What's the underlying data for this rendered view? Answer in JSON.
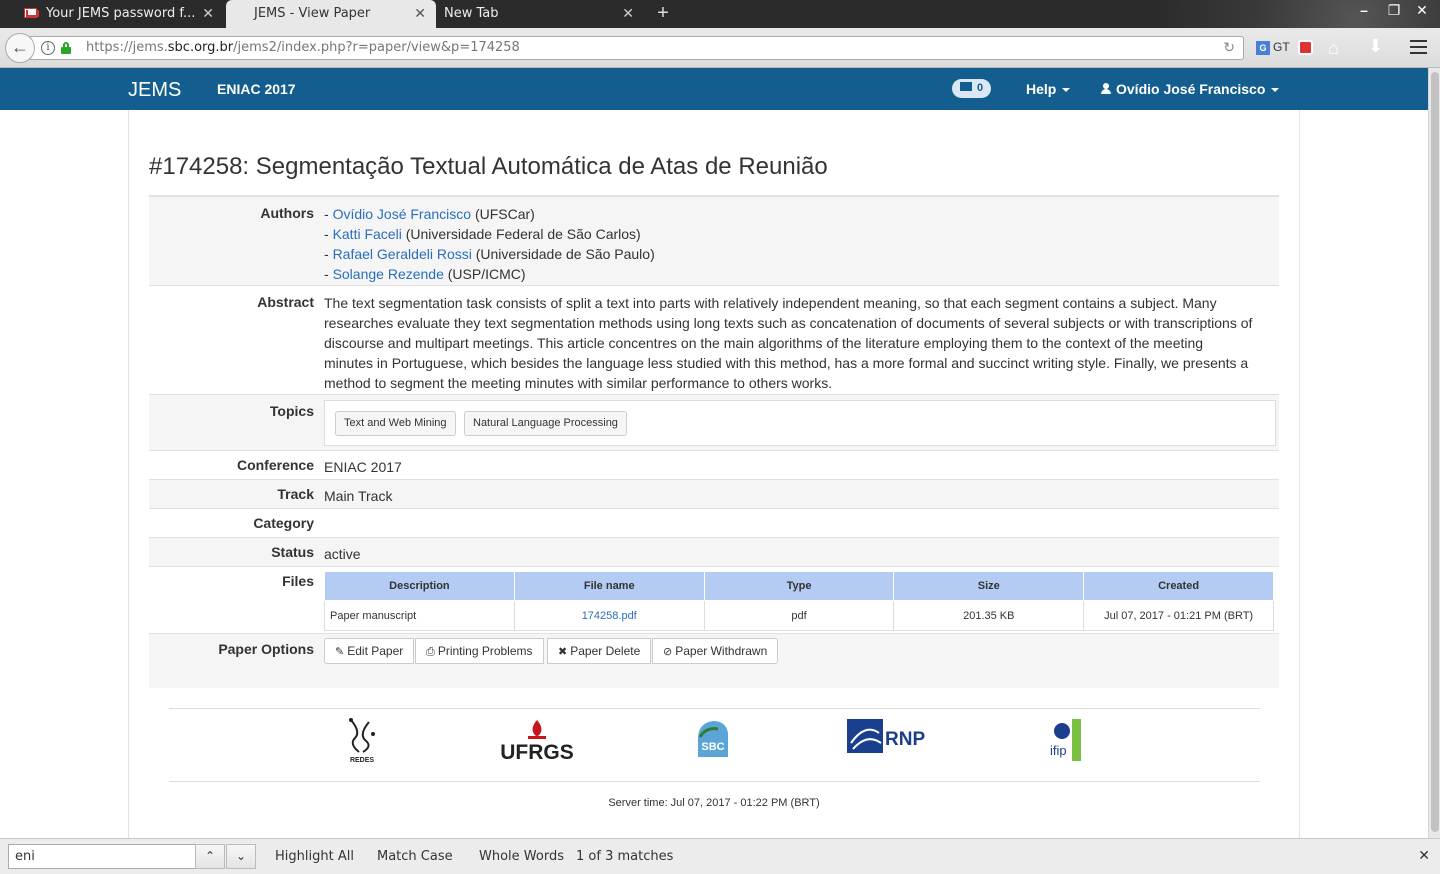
{
  "browser": {
    "tabs": [
      {
        "title": "Your JEMS password f...",
        "active": false
      },
      {
        "title": "JEMS - View Paper",
        "active": true
      },
      {
        "title": "New Tab",
        "active": false
      }
    ],
    "url_prefix": "https://jems.",
    "url_domain": "sbc.org.br",
    "url_suffix": "/jems2/index.php?r=paper/view&p=174258",
    "gt_label": "GT"
  },
  "app": {
    "brand": "JEMS",
    "conference": "ENIAC 2017",
    "messages_count": "0",
    "help_label": "Help",
    "user_name": "Ovídio José Francisco"
  },
  "paper": {
    "title": "#174258: Segmentação Textual Automática de Atas de Reunião",
    "labels": {
      "authors": "Authors",
      "abstract": "Abstract",
      "topics": "Topics",
      "conference": "Conference",
      "track": "Track",
      "category": "Category",
      "status": "Status",
      "files": "Files",
      "options": "Paper Options"
    },
    "authors": [
      {
        "name": "Ovídio José Francisco",
        "affiliation": "(UFSCar)"
      },
      {
        "name": "Katti Faceli",
        "affiliation": "(Universidade Federal de São Carlos)"
      },
      {
        "name": "Rafael Geraldeli Rossi",
        "affiliation": "(Universidade de São Paulo)"
      },
      {
        "name": "Solange Rezende",
        "affiliation": "(USP/ICMC)"
      }
    ],
    "abstract_lines": [
      "The text segmentation task consists of split a text into parts with relatively independent meaning, so that each segment contains a subject. Many",
      "researches evaluate they text segmentation methods using long texts such as concatenation of documents of several subjects or with transcriptions of",
      "discourse and multipart meetings. This article concentres on the main algorithms of the literature employing them to the context of the meeting",
      "minutes in Portuguese, which besides the language less studied with this method, has a more formal and succinct writing style. Finally, we presents a",
      "method to segment the meeting minutes with similar performance to others works."
    ],
    "topics": [
      "Text and Web Mining",
      "Natural Language Processing"
    ],
    "conference": "ENIAC 2017",
    "track": "Main Track",
    "category": "",
    "status": "active",
    "files": {
      "headers": [
        "Description",
        "File name",
        "Type",
        "Size",
        "Created"
      ],
      "rows": [
        [
          "Paper manuscript",
          "174258.pdf",
          "pdf",
          "201.35 KB",
          "Jul 07, 2017 - 01:21 PM (BRT)"
        ]
      ]
    },
    "options": [
      "Edit Paper",
      "Printing Problems",
      "Paper Delete",
      "Paper Withdrawn"
    ]
  },
  "footer": {
    "logos": [
      "REDES",
      "UFRGS",
      "SBC",
      "RNP",
      "ifip"
    ],
    "server_time": "Server time: Jul 07, 2017 - 01:22 PM (BRT)"
  },
  "findbar": {
    "query": "eni",
    "highlight_all": "Highlight All",
    "match_case": "Match Case",
    "whole_words": "Whole Words",
    "status": "1 of 3 matches"
  },
  "colors": {
    "app_nav": "#135e8e",
    "link": "#2a6ebb",
    "table_header": "#b4ccf4"
  }
}
